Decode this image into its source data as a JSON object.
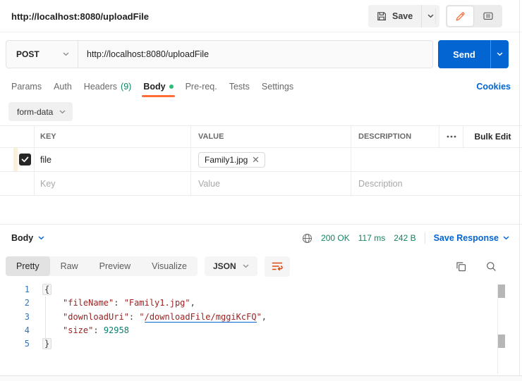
{
  "colors": {
    "accent_orange": "#ff6c37",
    "action_blue": "#0265d2",
    "success_green": "#0e8662"
  },
  "header": {
    "title": "http://localhost:8080/uploadFile",
    "save_label": "Save"
  },
  "request": {
    "method": "POST",
    "url": "http://localhost:8080/uploadFile",
    "send_label": "Send"
  },
  "request_tabs": {
    "params": "Params",
    "auth": "Auth",
    "headers": "Headers",
    "headers_count": "(9)",
    "body": "Body",
    "prereq": "Pre-req.",
    "tests": "Tests",
    "settings": "Settings",
    "cookies": "Cookies",
    "active": "Body"
  },
  "body_section": {
    "type": "form-data"
  },
  "form_table": {
    "headers": {
      "key": "KEY",
      "value": "VALUE",
      "description": "DESCRIPTION",
      "bulk_edit": "Bulk Edit"
    },
    "rows": [
      {
        "selected": true,
        "key": "file",
        "value_chip": "Family1.jpg",
        "description": ""
      }
    ],
    "placeholder": {
      "key": "Key",
      "value": "Value",
      "description": "Description"
    }
  },
  "response": {
    "pane_label": "Body",
    "status": "200 OK",
    "time": "117 ms",
    "size": "242 B",
    "save_label": "Save Response",
    "view_tabs": {
      "pretty": "Pretty",
      "raw": "Raw",
      "preview": "Preview",
      "visualize": "Visualize",
      "active": "Pretty"
    },
    "format": "JSON",
    "line_numbers": [
      "1",
      "2",
      "3",
      "4",
      "5"
    ],
    "json": {
      "open_brace": "{",
      "close_brace": "}",
      "line2": {
        "key": "\"fileName\"",
        "sep": ": ",
        "value": "\"Family1.jpg\"",
        "comma": ","
      },
      "line3": {
        "key": "\"downloadUri\"",
        "sep": ": ",
        "quote_open": "\"",
        "link": "/downloadFile/mggiKcFQ",
        "quote_close": "\"",
        "comma": ","
      },
      "line4": {
        "key": "\"size\"",
        "sep": ": ",
        "value": "92958"
      }
    }
  }
}
